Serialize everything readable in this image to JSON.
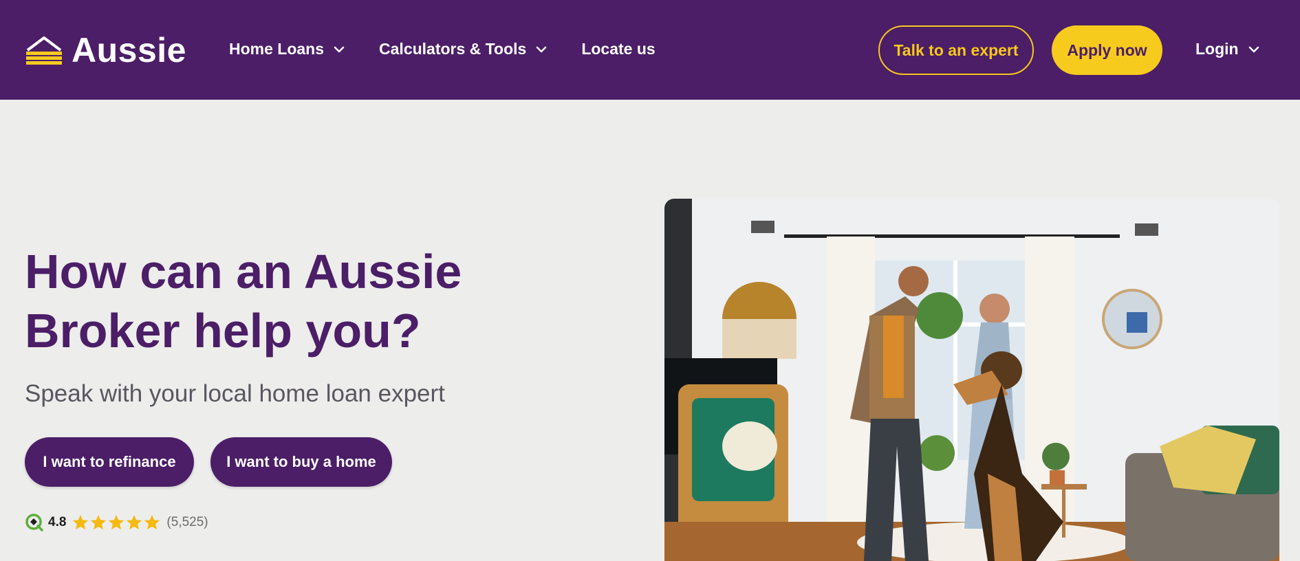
{
  "header": {
    "logo_text": "Aussie",
    "nav": [
      {
        "label": "Home Loans",
        "dropdown": true
      },
      {
        "label": "Calculators & Tools",
        "dropdown": true
      },
      {
        "label": "Locate us",
        "dropdown": false
      }
    ],
    "talk_label": "Talk to an expert",
    "apply_label": "Apply now",
    "login_label": "Login"
  },
  "hero": {
    "title": "How can an Aussie Broker help you?",
    "subtitle": "Speak with your local home loan expert",
    "buttons": {
      "refinance": "I want to refinance",
      "buy": "I want to buy a home"
    },
    "rating": {
      "score": "4.8",
      "count": "(5,525)",
      "stars": 5
    }
  },
  "colors": {
    "brand_purple": "#4b1e67",
    "brand_yellow": "#f7cb1d",
    "background": "#ededeb"
  },
  "icons": [
    "aussie-logo-icon",
    "chevron-down-icon",
    "productreview-icon",
    "star-icon"
  ]
}
